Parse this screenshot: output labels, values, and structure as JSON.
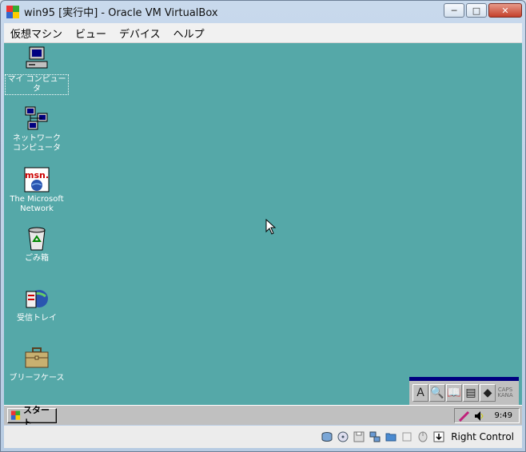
{
  "window": {
    "title": "win95 [実行中] - Oracle VM VirtualBox",
    "minimize": "─",
    "maximize": "□",
    "close": "✕"
  },
  "vb_menu": [
    "仮想マシン",
    "ビュー",
    "デバイス",
    "ヘルプ"
  ],
  "desktop": {
    "background": "#55a8a8",
    "icons": [
      {
        "name": "my-computer",
        "label_lines": [
          "マイ コンピュータ"
        ],
        "icon": "computer-icon"
      },
      {
        "name": "network-neighborhood",
        "label_lines": [
          "ネットワーク",
          "コンピュータ"
        ],
        "icon": "network-icon"
      },
      {
        "name": "msn",
        "label_lines": [
          "The Microsoft",
          "Network"
        ],
        "icon": "msn-icon"
      },
      {
        "name": "recycle-bin",
        "label_lines": [
          "ごみ箱"
        ],
        "icon": "recycle-bin-icon"
      },
      {
        "name": "inbox",
        "label_lines": [
          "受信トレイ"
        ],
        "icon": "inbox-icon"
      },
      {
        "name": "briefcase",
        "label_lines": [
          "ブリーフケース"
        ],
        "icon": "briefcase-icon"
      }
    ],
    "msn_logo_text": "msn."
  },
  "ime_toolbar": {
    "buttons": [
      "A",
      "🔍",
      "📖",
      "▤",
      "◆"
    ],
    "kana_text": [
      "CAPS",
      "KANA"
    ]
  },
  "taskbar": {
    "start_label": "スタート",
    "clock": "9:49"
  },
  "vb_status": {
    "host_key": "Right Control"
  }
}
